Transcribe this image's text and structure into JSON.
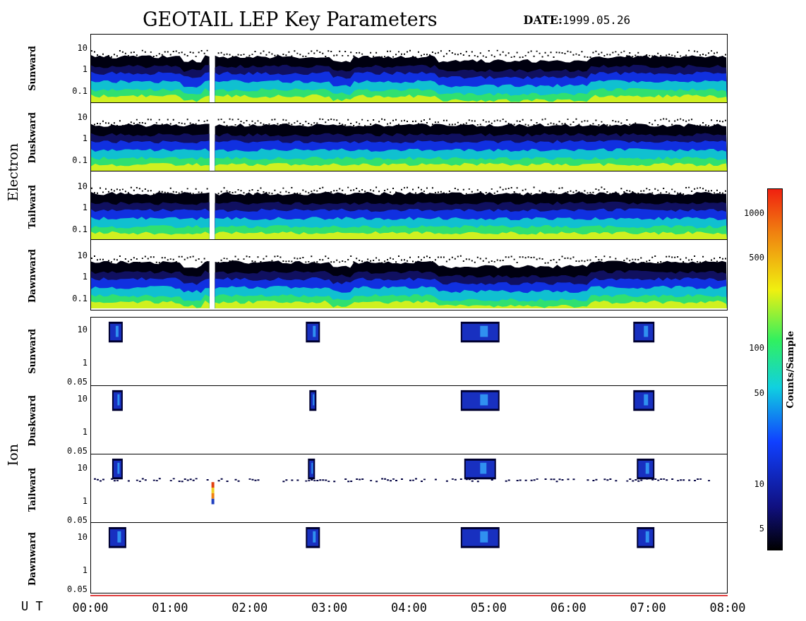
{
  "title": "GEOTAIL LEP Key Parameters",
  "date": {
    "label": "DATE:",
    "value": "1999.05.26"
  },
  "groups": [
    {
      "label": "Electron",
      "kind": "electron",
      "panels": [
        {
          "label": "Sunward",
          "y_ticks": [
            "10",
            "1",
            "0.1"
          ]
        },
        {
          "label": "Duskward",
          "y_ticks": [
            "10",
            "1",
            "0.1"
          ]
        },
        {
          "label": "Tailward",
          "y_ticks": [
            "10",
            "1",
            "0.1"
          ]
        },
        {
          "label": "Dawnward",
          "y_ticks": [
            "10",
            "1",
            "0.1"
          ]
        }
      ]
    },
    {
      "label": "Ion",
      "kind": "ion",
      "panels": [
        {
          "label": "Sunward",
          "y_ticks": [
            "10",
            "1",
            "0.05"
          ]
        },
        {
          "label": "Duskward",
          "y_ticks": [
            "10",
            "1",
            "0.05"
          ]
        },
        {
          "label": "Tailward",
          "y_ticks": [
            "10",
            "1",
            "0.05"
          ]
        },
        {
          "label": "Dawnward",
          "y_ticks": [
            "10",
            "1",
            "0.05"
          ]
        }
      ]
    }
  ],
  "x_axis": {
    "label": "U T",
    "ticks": [
      "00:00",
      "01:00",
      "02:00",
      "03:00",
      "04:00",
      "05:00",
      "06:00",
      "07:00",
      "08:00"
    ]
  },
  "colorbar": {
    "label": "Counts/Sample",
    "ticks": [
      "1000",
      "500",
      "100",
      "50",
      "10",
      "5"
    ]
  }
}
